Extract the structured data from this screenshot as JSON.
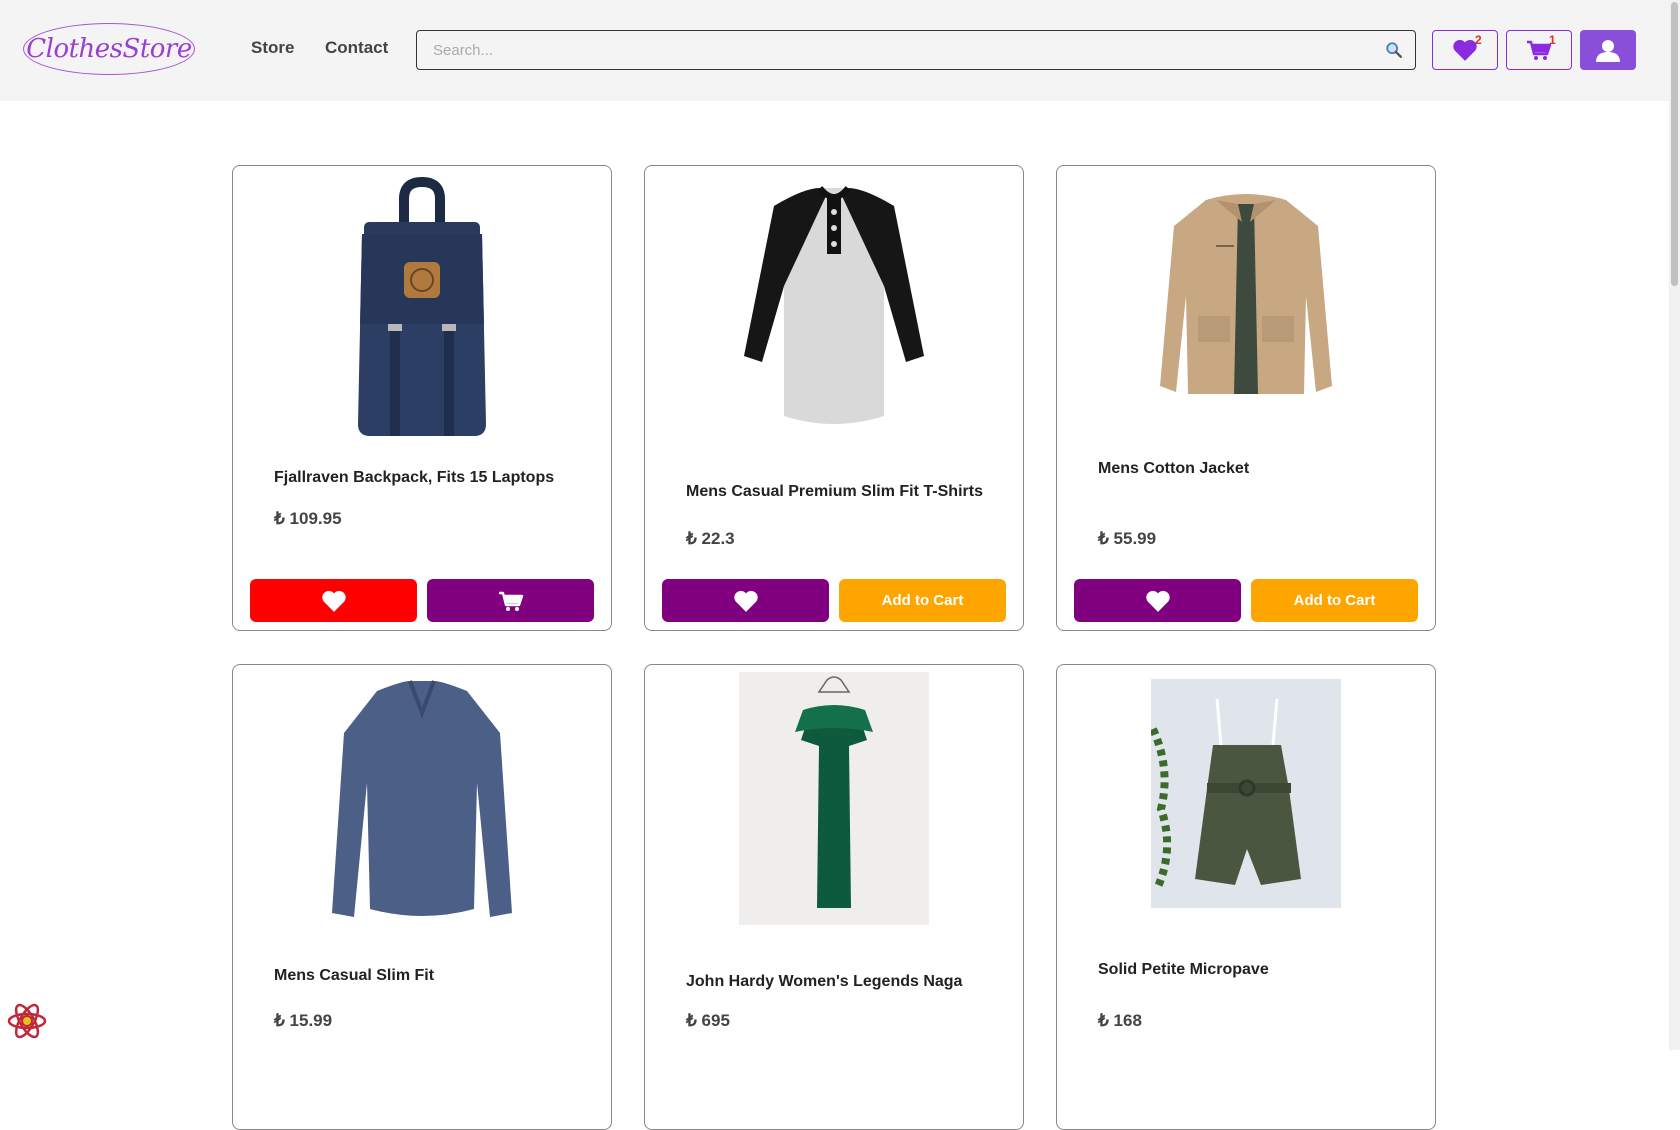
{
  "header": {
    "logo_text": "ClothesStore",
    "nav": [
      {
        "label": "Store"
      },
      {
        "label": "Contact"
      }
    ],
    "search_placeholder": "Search...",
    "favorites_count": "2",
    "cart_count": "1"
  },
  "colors": {
    "brand_purple": "#8a4fd8",
    "purple": "#800080",
    "red": "#ff0000",
    "orange": "#ffa500"
  },
  "products": [
    {
      "title": "Fjallraven Backpack, Fits 15 Laptops",
      "price": "₺ 109.95",
      "add_to_cart_label": "",
      "favorited": true,
      "in_cart": true,
      "image_icon": "backpack-image"
    },
    {
      "title": "Mens Casual Premium Slim Fit T-Shirts",
      "price": "₺ 22.3",
      "add_to_cart_label": "Add to Cart",
      "favorited": false,
      "in_cart": false,
      "image_icon": "tshirt-image"
    },
    {
      "title": "Mens Cotton Jacket",
      "price": "₺ 55.99",
      "add_to_cart_label": "Add to Cart",
      "favorited": false,
      "in_cart": false,
      "image_icon": "jacket-image"
    },
    {
      "title": "Mens Casual Slim Fit",
      "price": "₺ 15.99",
      "image_icon": "longsleeve-image"
    },
    {
      "title": "John Hardy Women's Legends Naga",
      "price": "₺ 695",
      "image_icon": "dress-image"
    },
    {
      "title": "Solid Petite Micropave",
      "price": "₺ 168",
      "image_icon": "romper-image"
    }
  ]
}
